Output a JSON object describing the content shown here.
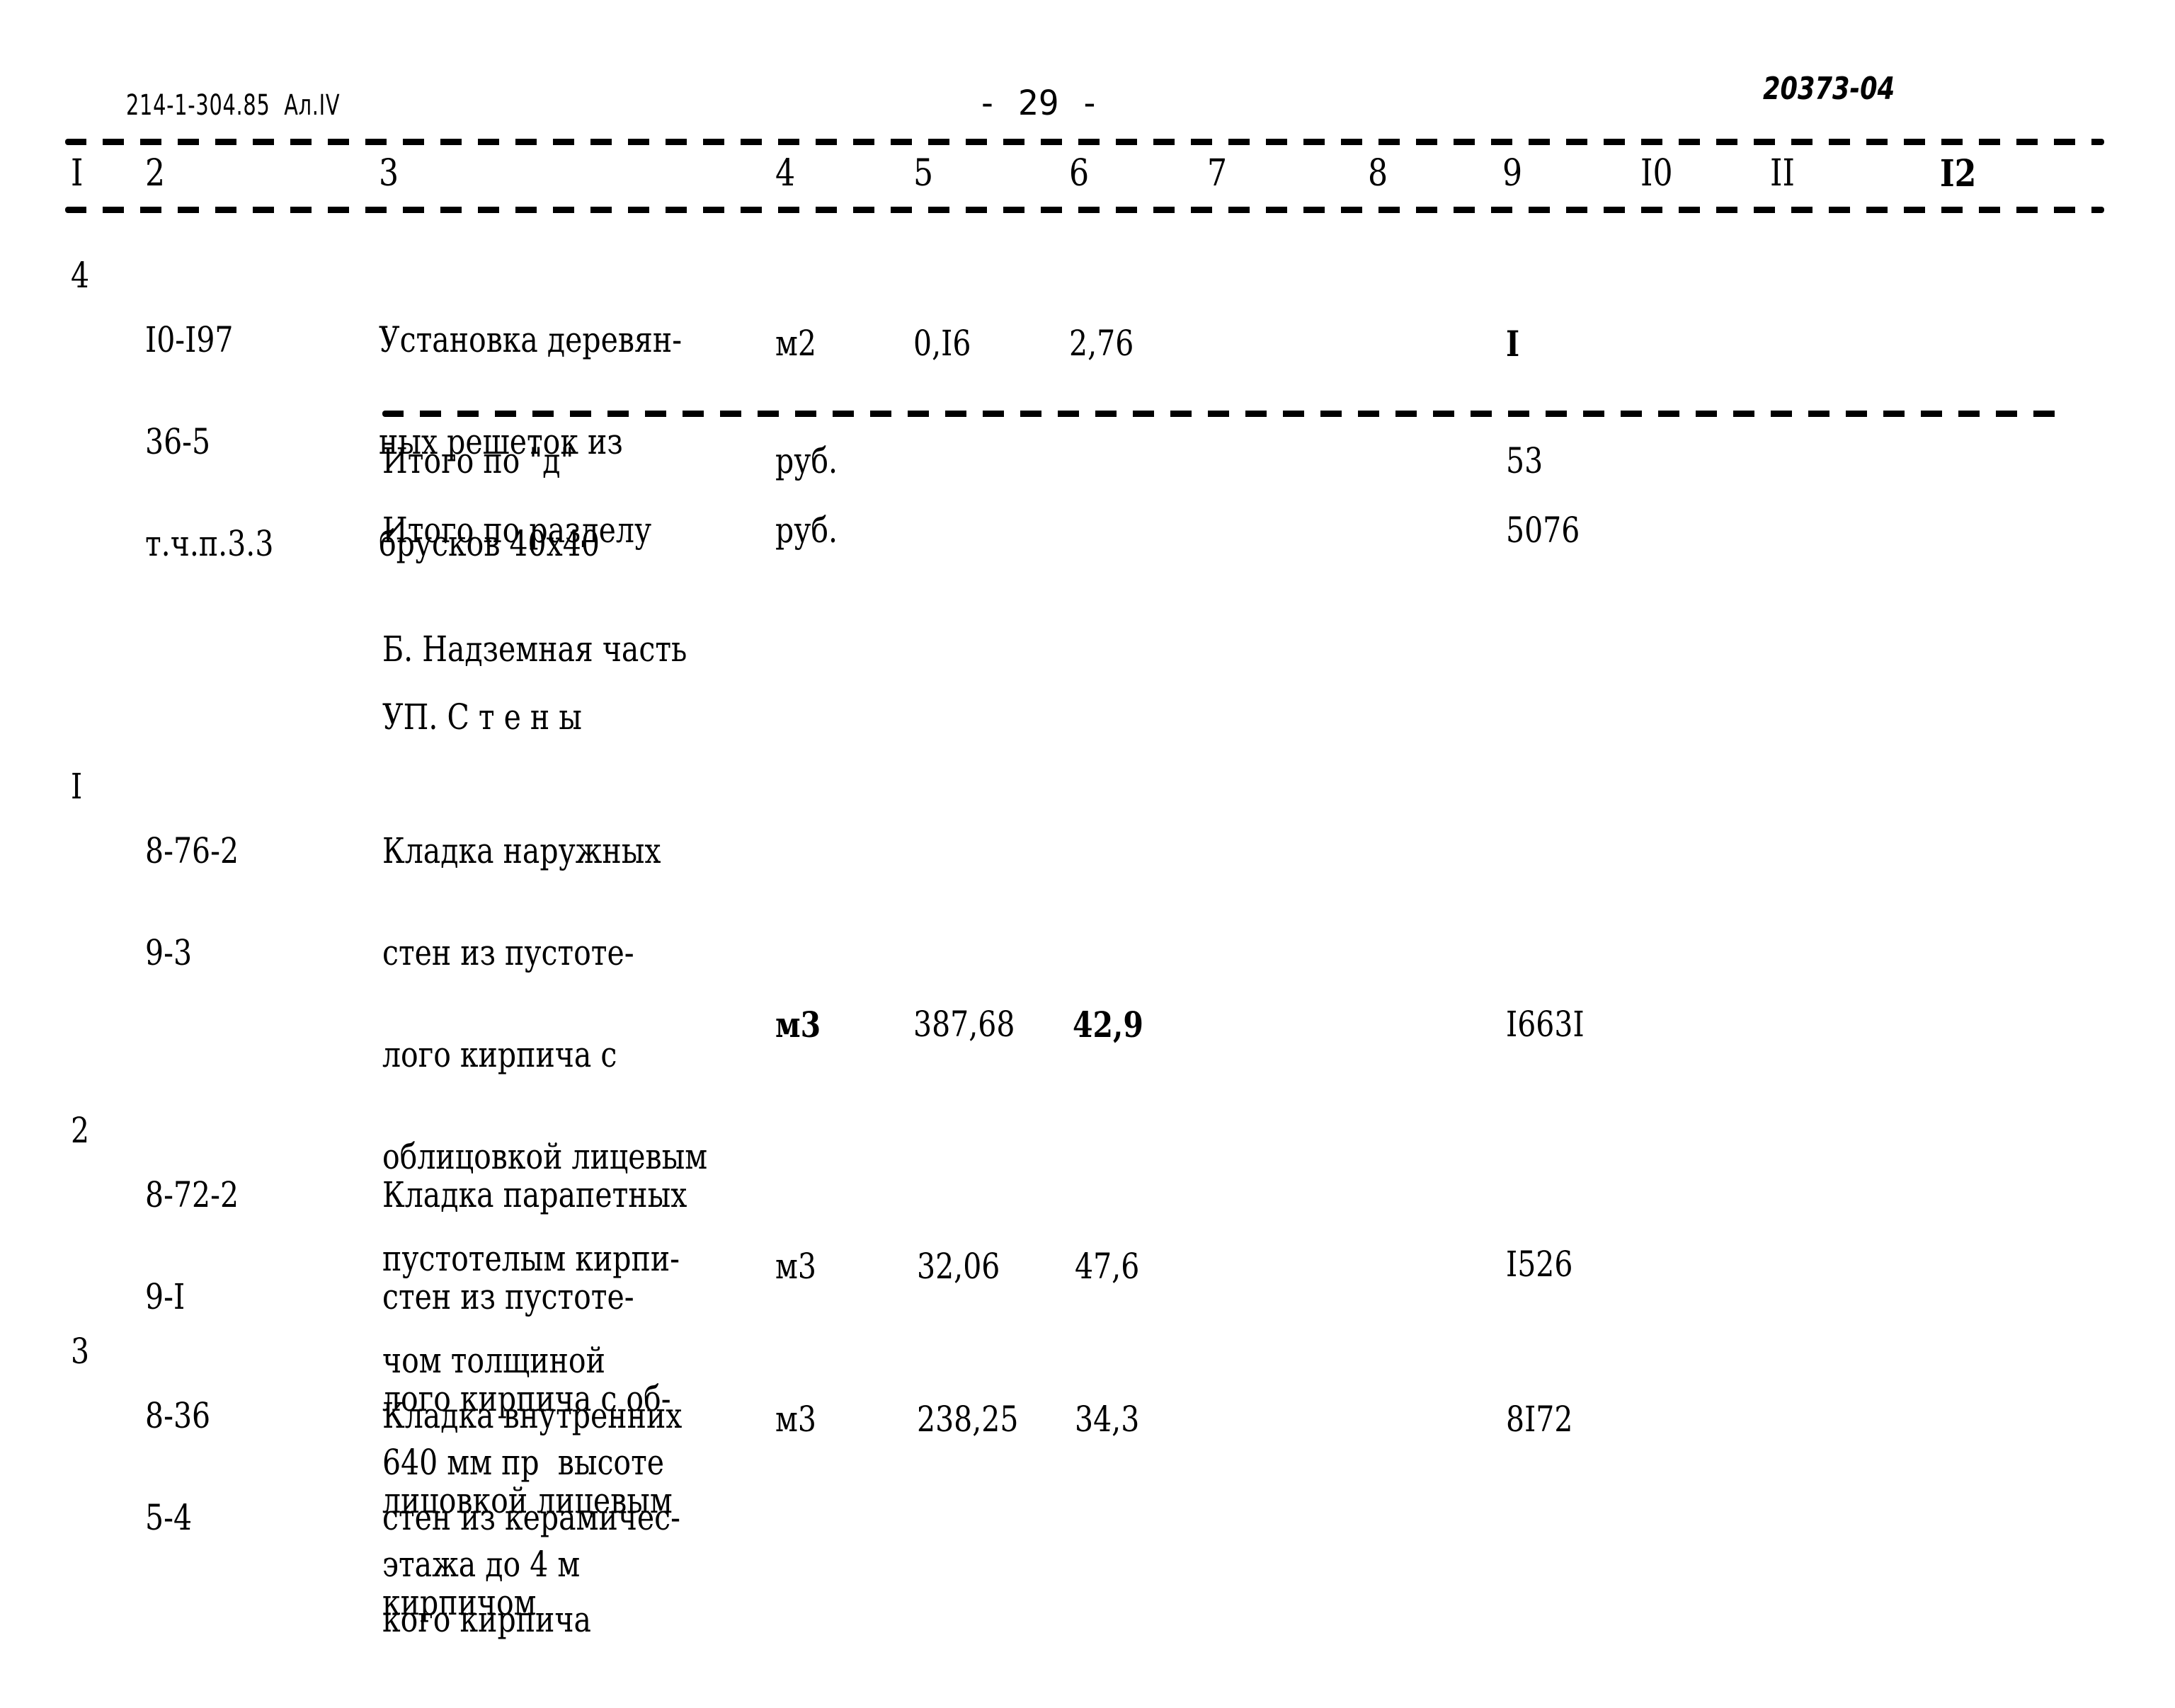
{
  "header": {
    "doc_code": "214-1-304.85  Ал.IV",
    "page_number": "- 29 -",
    "inventory_number": "20373-04"
  },
  "columns": [
    "I",
    "2",
    "3",
    "4",
    "5",
    "6",
    "7",
    "8",
    "9",
    "I0",
    "II",
    "I2"
  ],
  "section_a_tail": {
    "rows": [
      {
        "num": "4",
        "code_lines": [
          "I0-I97",
          "36-5",
          "т.ч.п.3.3"
        ],
        "desc_lines": [
          "Установка деревян-",
          "ных решеток из",
          "брусков 40х40"
        ],
        "unit": "м2",
        "qty": "0,I6",
        "price": "2,76",
        "col9": "I"
      }
    ],
    "totals": [
      {
        "label": "Итого по \"д\"",
        "unit": "руб.",
        "value": "53"
      },
      {
        "label": "Итого по разделу",
        "unit": "руб.",
        "value": "5076"
      }
    ]
  },
  "section_b": {
    "title": "Б. Надземная часть",
    "subsection": "УП. С т е н ы",
    "rows": [
      {
        "num": "I",
        "code_lines": [
          "8-76-2",
          "9-3"
        ],
        "desc_lines": [
          "Кладка наружных",
          "стен из пустоте-",
          "лого кирпича с",
          "облицовкой лицевым",
          "пустотелым кирпи-",
          "чом толщиной",
          "640 мм пр  высоте",
          "этажа до 4 м"
        ],
        "unit": "м3",
        "qty": "387,68",
        "price": "42,9",
        "col9": "I663I"
      },
      {
        "num": "2",
        "code_lines": [
          "8-72-2",
          "9-I"
        ],
        "desc_lines": [
          "Кладка парапетных",
          "стен из пустоте-",
          "лого кирпича с об-",
          "лицовкой лицевым",
          "кирпичом"
        ],
        "unit": "м3",
        "qty": "32,06",
        "price": "47,6",
        "col9": "I526"
      },
      {
        "num": "3",
        "code_lines": [
          "8-36",
          "5-4"
        ],
        "desc_lines": [
          "Кладка внутренних",
          "стен из керамичес-",
          "кого кирпича"
        ],
        "unit": "м3",
        "qty": "238,25",
        "price": "34,3",
        "col9": "8I72"
      }
    ]
  }
}
